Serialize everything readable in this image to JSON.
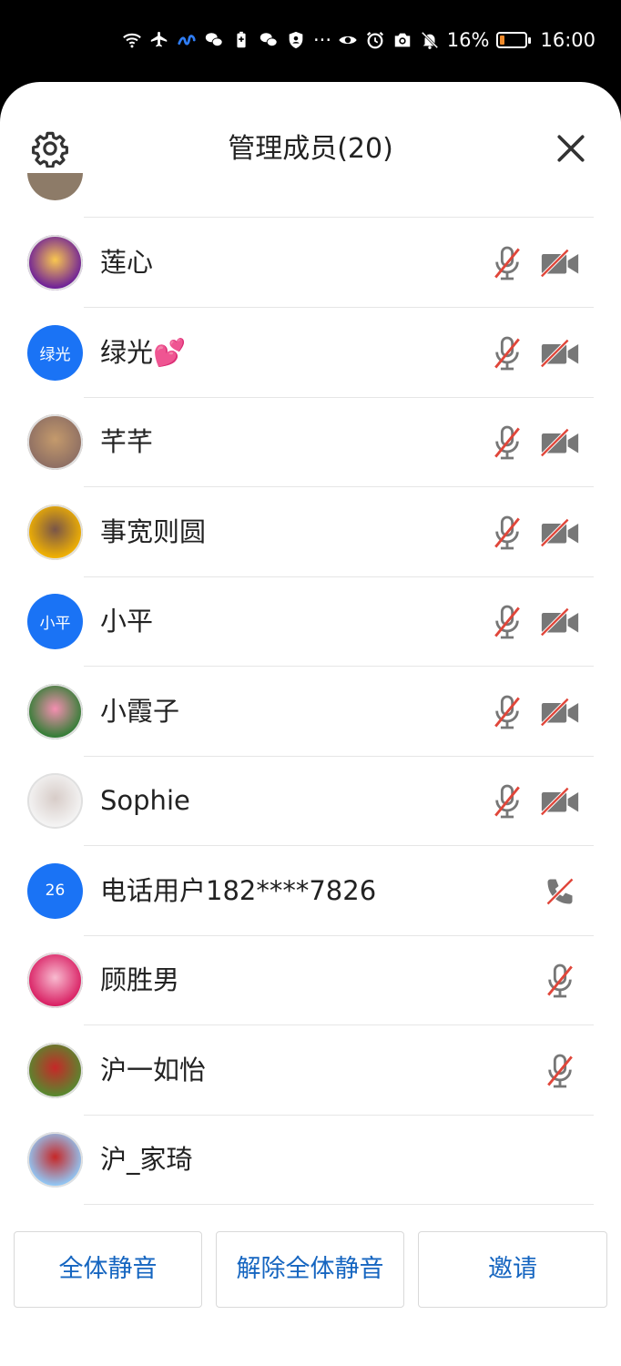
{
  "status_bar": {
    "battery_percent": "16%",
    "battery_level": 0.16,
    "battery_color": "#f08a2a",
    "time": "16:00",
    "ellipsis": "···",
    "left_icons": [
      "wifi-icon",
      "airplane-icon",
      "app-icon",
      "wechat-icon",
      "battery-saver-icon",
      "wechat-icon",
      "shield-icon"
    ],
    "right_icons": [
      "eye-icon",
      "alarm-icon",
      "camera-icon",
      "bell-off-icon"
    ]
  },
  "header": {
    "title": "管理成员(20)",
    "settings_icon": "gear-icon",
    "close_icon": "close-icon"
  },
  "members": [
    {
      "name": "莲心",
      "avatar_type": "photo",
      "avatar_colors": [
        "#6a1b9a",
        "#f9c74f"
      ],
      "mic": "muted",
      "camera": "off"
    },
    {
      "name": "绿光💕",
      "avatar_type": "text",
      "avatar_text": "绿光",
      "mic": "muted",
      "camera": "off"
    },
    {
      "name": "芊芊",
      "avatar_type": "photo",
      "avatar_colors": [
        "#8d6e63",
        "#c49a6c"
      ],
      "mic": "muted",
      "camera": "off"
    },
    {
      "name": "事宽则圆",
      "avatar_type": "photo",
      "avatar_colors": [
        "#f4b400",
        "#795548"
      ],
      "mic": "muted",
      "camera": "off"
    },
    {
      "name": "小平",
      "avatar_type": "text",
      "avatar_text": "小平",
      "mic": "muted",
      "camera": "off"
    },
    {
      "name": "小霞子",
      "avatar_type": "photo",
      "avatar_colors": [
        "#2e7d32",
        "#f48fb1"
      ],
      "mic": "muted",
      "camera": "off"
    },
    {
      "name": "Sophie",
      "avatar_type": "photo",
      "avatar_colors": [
        "#f5f5f5",
        "#d7ccc8"
      ],
      "mic": "muted",
      "camera": "off"
    },
    {
      "name": "电话用户182****7826",
      "avatar_type": "text",
      "avatar_text": "26",
      "phone": "muted"
    },
    {
      "name": "顾胜男",
      "avatar_type": "photo",
      "avatar_colors": [
        "#d81b60",
        "#f8bbd0"
      ],
      "mic": "muted"
    },
    {
      "name": "沪一如怡",
      "avatar_type": "photo",
      "avatar_colors": [
        "#558b2f",
        "#c62828"
      ],
      "mic": "muted"
    },
    {
      "name": "沪_家琦",
      "avatar_type": "photo",
      "avatar_colors": [
        "#90caf9",
        "#c62828"
      ]
    }
  ],
  "footer": {
    "mute_all": "全体静音",
    "unmute_all": "解除全体静音",
    "invite": "邀请"
  },
  "colors": {
    "accent": "#1565c0",
    "avatar_blue": "#1a73f5",
    "muted_slash": "#e0463a",
    "icon_gray": "#777777"
  }
}
